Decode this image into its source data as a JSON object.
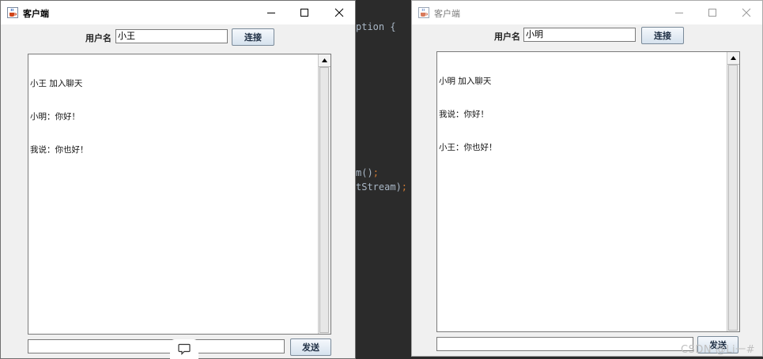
{
  "background_editor": {
    "lines": [
      {
        "text": "ption {",
        "punct": ""
      },
      {
        "text": "m()",
        "punct": ";"
      },
      {
        "text": "tStream)",
        "punct": ";"
      }
    ]
  },
  "windows": [
    {
      "title": "客户端",
      "username_label": "用户名",
      "username_value": "小王",
      "connect_label": "连接",
      "messages": [
        "小王 加入聊天",
        "小明：你好！",
        "我说：你也好！"
      ],
      "message_input": "",
      "send_label": "发送",
      "active": true
    },
    {
      "title": "客户端",
      "username_label": "用户名",
      "username_value": "小明",
      "connect_label": "连接",
      "messages": [
        "小明 加入聊天",
        "我说：你好！",
        "小王：你也好！"
      ],
      "message_input": "",
      "send_label": "发送",
      "active": false
    }
  ],
  "icons": {
    "app": "java-cup-icon",
    "minimize": "minimize-icon",
    "maximize": "maximize-icon",
    "close": "close-icon",
    "scroll_up": "scroll-up-arrow-icon",
    "comment": "comment-bubble-icon"
  },
  "watermark": "CSDN @Li一#",
  "colors": {
    "editor_bg": "#2b2b2b",
    "editor_text": "#a9b7c6",
    "editor_punct": "#cc7832",
    "window_bg": "#f0f0f0"
  }
}
